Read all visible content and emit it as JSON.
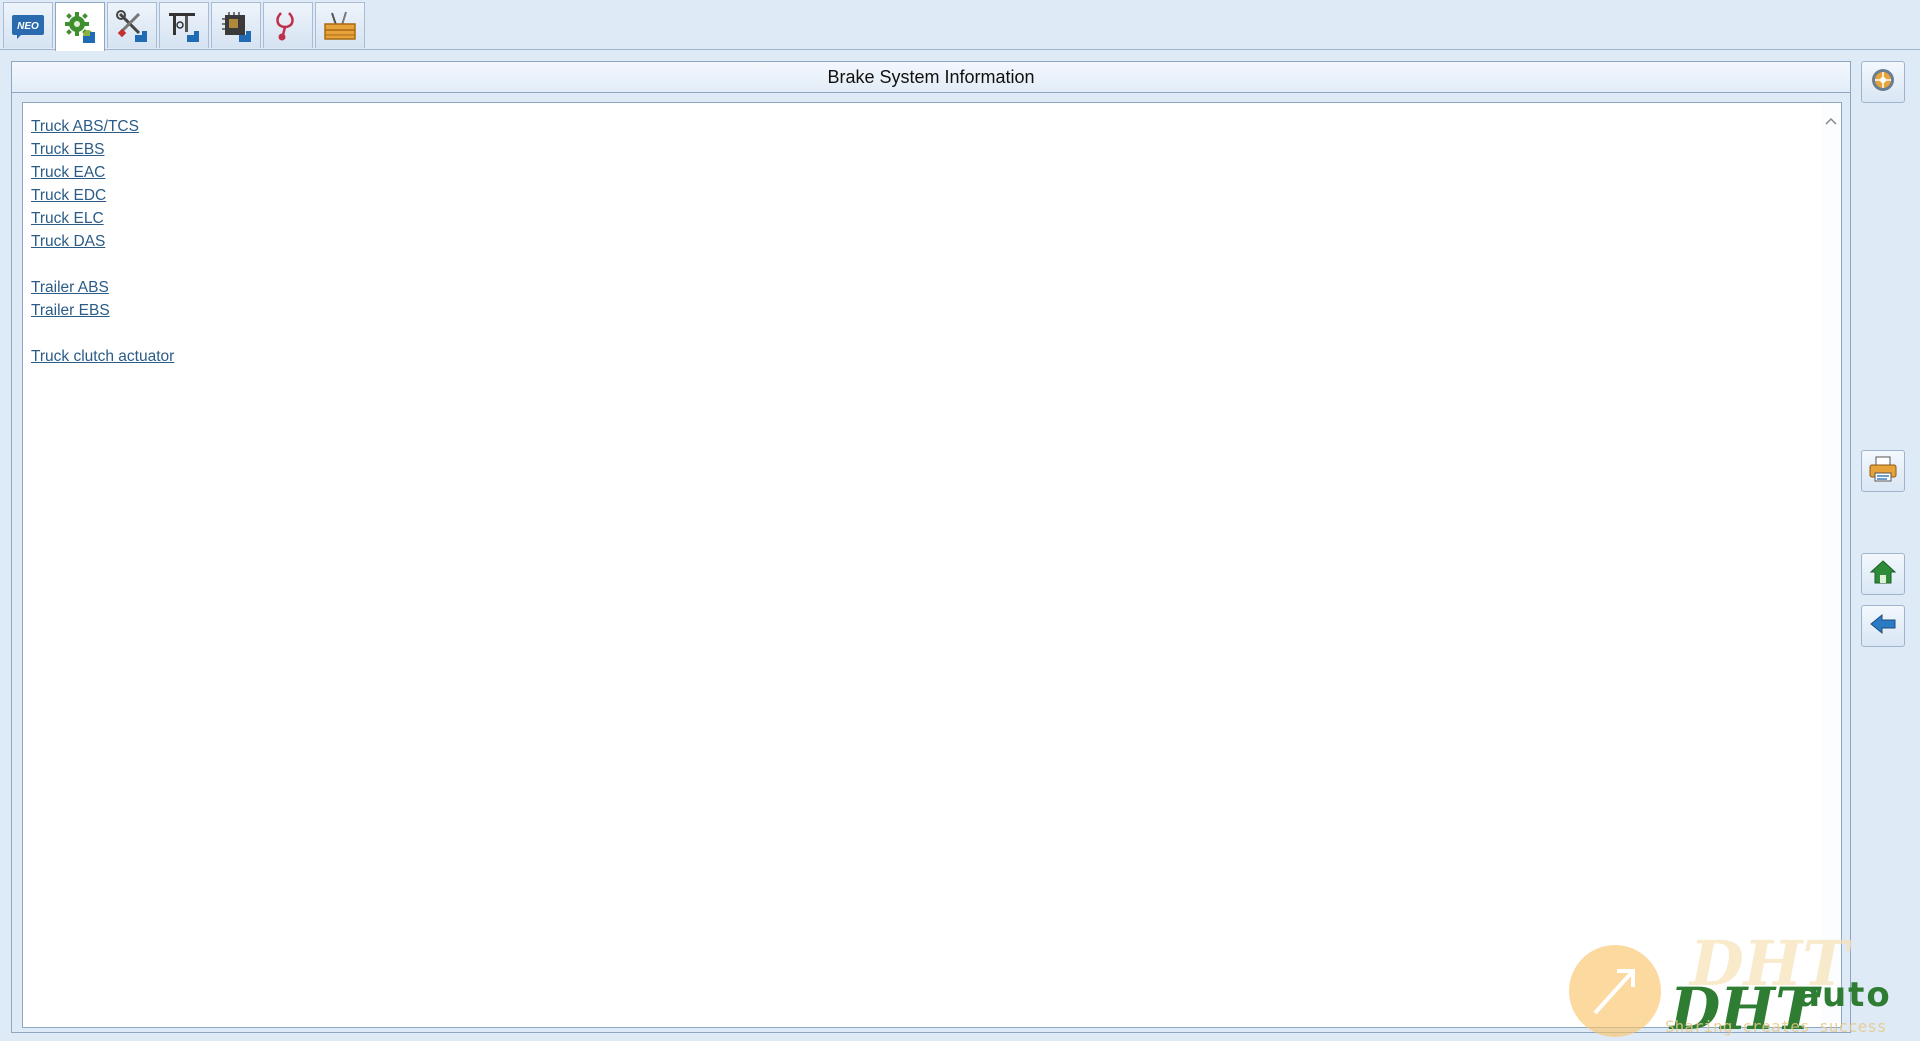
{
  "toolbar": {
    "tabs": [
      {
        "name": "neo-tab",
        "icon": "neo-logo-icon",
        "label": "NEO"
      },
      {
        "name": "system-info-tab",
        "icon": "gear-info-icon"
      },
      {
        "name": "repair-tools-tab",
        "icon": "wrench-screwdriver-icon"
      },
      {
        "name": "measurement-tab",
        "icon": "caliper-icon"
      },
      {
        "name": "ecu-tab",
        "icon": "chip-icon"
      },
      {
        "name": "diagnosis-tab",
        "icon": "stethoscope-icon"
      },
      {
        "name": "toolbox-tab",
        "icon": "toolbox-icon"
      }
    ],
    "active_tab": 1
  },
  "panel": {
    "title": "Brake System Information"
  },
  "links": {
    "truck": [
      "Truck ABS/TCS",
      "Truck EBS",
      "Truck EAC",
      "Truck EDC",
      "Truck ELC",
      "Truck DAS"
    ],
    "trailer": [
      "Trailer ABS",
      "Trailer EBS"
    ],
    "other": [
      "Truck clutch actuator"
    ]
  },
  "side_buttons": [
    {
      "name": "settings-button",
      "icon": "steering-wheel-icon"
    },
    {
      "name": "print-button",
      "icon": "printer-icon"
    },
    {
      "name": "home-button",
      "icon": "home-icon"
    },
    {
      "name": "back-button",
      "icon": "back-arrow-icon"
    }
  ],
  "watermark": {
    "brand": "DHT",
    "suffix": "auto",
    "tagline": "Sharing creates success"
  },
  "colors": {
    "background": "#dfeaf7",
    "link": "#2a5c87",
    "border": "#8ea6c2",
    "watermark_green": "#2e7d32",
    "watermark_orange": "#f9c46b"
  }
}
